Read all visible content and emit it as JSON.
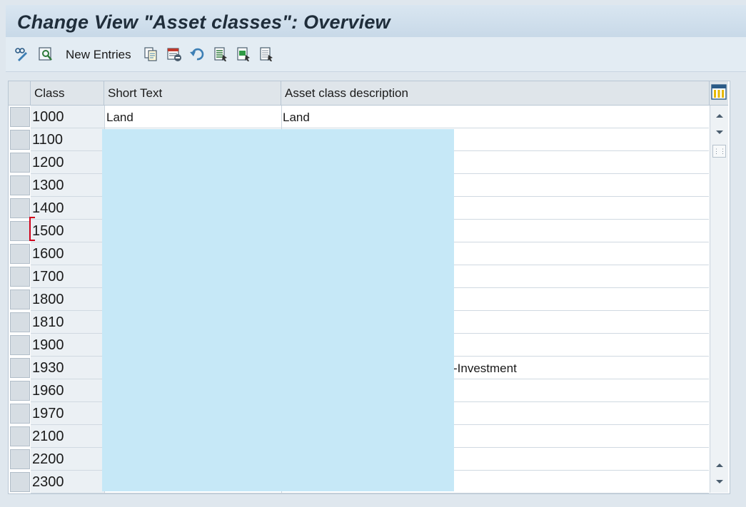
{
  "window": {
    "title": "Change View \"Asset classes\": Overview"
  },
  "toolbar": {
    "items": [
      {
        "icon": "display-change-icon"
      },
      {
        "icon": "find-icon"
      },
      {
        "label": "New Entries"
      },
      {
        "icon": "copy-as-icon"
      },
      {
        "icon": "delete-icon"
      },
      {
        "icon": "undo-change-icon"
      },
      {
        "icon": "select-all-icon"
      },
      {
        "icon": "select-block-icon"
      },
      {
        "icon": "deselect-all-icon"
      }
    ],
    "new_entries_label": "New Entries"
  },
  "table": {
    "columns": [
      "Class",
      "Short Text",
      "Asset class description"
    ],
    "rows": [
      {
        "class": "1000",
        "short_text": "Land",
        "description": "Land"
      },
      {
        "class": "1100",
        "short_text": "",
        "description": ""
      },
      {
        "class": "1200",
        "short_text": "",
        "description": ""
      },
      {
        "class": "1300",
        "short_text": "",
        "description": ""
      },
      {
        "class": "1400",
        "short_text": "",
        "description": ""
      },
      {
        "class": "1500",
        "short_text": "",
        "description": ""
      },
      {
        "class": "1600",
        "short_text": "",
        "description": ""
      },
      {
        "class": "1700",
        "short_text": "",
        "description": ""
      },
      {
        "class": "1800",
        "short_text": "",
        "description": ""
      },
      {
        "class": "1810",
        "short_text": "",
        "description": ""
      },
      {
        "class": "1900",
        "short_text": "",
        "description": ""
      },
      {
        "class": "1930",
        "short_text": "",
        "description": "-Investment"
      },
      {
        "class": "1960",
        "short_text": "",
        "description": ""
      },
      {
        "class": "1970",
        "short_text": "",
        "description": ""
      },
      {
        "class": "2100",
        "short_text": "",
        "description": ""
      },
      {
        "class": "2200",
        "short_text": "",
        "description": ""
      },
      {
        "class": "2300",
        "short_text": "",
        "description": ""
      }
    ]
  },
  "colors": {
    "redaction": "#c6e8f7",
    "header_bg": "#dfe5ea",
    "title_bg": "#c8d9e8",
    "focus": "#d0021b"
  }
}
